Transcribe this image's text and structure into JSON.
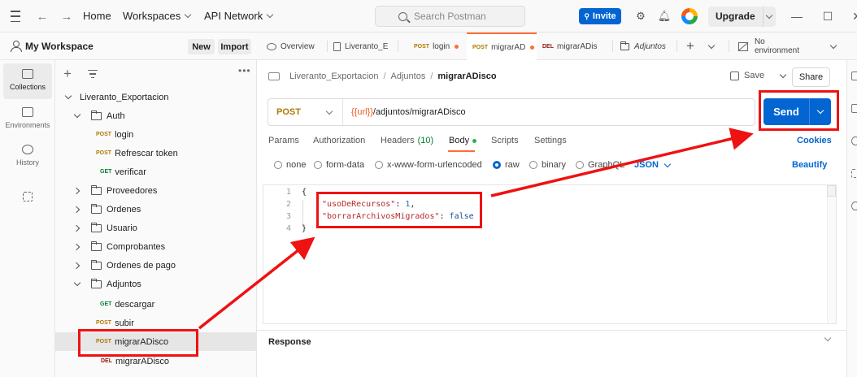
{
  "topbar": {
    "home": "Home",
    "workspaces": "Workspaces",
    "api_network": "API Network",
    "search_placeholder": "Search Postman",
    "invite": "Invite",
    "upgrade": "Upgrade"
  },
  "rail": {
    "items": [
      {
        "label": "Collections",
        "icon": "collections-icon"
      },
      {
        "label": "Environments",
        "icon": "environments-icon"
      },
      {
        "label": "History",
        "icon": "history-icon"
      },
      {
        "label": "",
        "icon": "apps-icon"
      }
    ]
  },
  "workspace": {
    "title": "My Workspace",
    "new_label": "New",
    "import_label": "Import"
  },
  "tree": {
    "collection": "Liveranto_Exportacion",
    "items": [
      {
        "type": "folder",
        "label": "Auth",
        "expanded": true
      },
      {
        "type": "request",
        "method": "POST",
        "label": "login"
      },
      {
        "type": "request",
        "method": "POST",
        "label": "Refrescar token"
      },
      {
        "type": "request",
        "method": "GET",
        "label": "verificar"
      },
      {
        "type": "folder",
        "label": "Proveedores",
        "expanded": false
      },
      {
        "type": "folder",
        "label": "Ordenes",
        "expanded": false
      },
      {
        "type": "folder",
        "label": "Usuario",
        "expanded": false
      },
      {
        "type": "folder",
        "label": "Comprobantes",
        "expanded": false
      },
      {
        "type": "folder",
        "label": "Ordenes de pago",
        "expanded": false
      },
      {
        "type": "folder",
        "label": "Adjuntos",
        "expanded": true
      },
      {
        "type": "request",
        "method": "GET",
        "label": "descargar"
      },
      {
        "type": "request",
        "method": "POST",
        "label": "subir"
      },
      {
        "type": "request",
        "method": "POST",
        "label": "migrarADisco",
        "selected": true
      },
      {
        "type": "request",
        "method": "DEL",
        "label": "migrarADisco"
      }
    ]
  },
  "tabs": {
    "items": [
      {
        "label": "Overview",
        "method": "",
        "icon": "overview-icon",
        "dirty": false
      },
      {
        "label": "Liveranto_E",
        "method": "",
        "icon": "collection-icon",
        "dirty": false
      },
      {
        "label": "login",
        "method": "POST",
        "dirty": true
      },
      {
        "label": "migrarAD",
        "method": "POST",
        "dirty": true,
        "active": true
      },
      {
        "label": "migrarADis",
        "method": "DEL",
        "dirty": false
      },
      {
        "label": "Adjuntos",
        "method": "",
        "icon": "folder-icon",
        "dirty": false
      }
    ],
    "environment": "No environment"
  },
  "request": {
    "breadcrumb": [
      "Liveranto_Exportacion",
      "Adjuntos",
      "migrarADisco"
    ],
    "save_label": "Save",
    "share_label": "Share",
    "method": "POST",
    "url_var": "{{url}}",
    "url_path": "/adjuntos/migrarADisco",
    "send_label": "Send",
    "subtabs": [
      "Params",
      "Authorization",
      "Headers",
      "Body",
      "Scripts",
      "Settings"
    ],
    "headers_count": "(10)",
    "cookies_label": "Cookies",
    "body_modes": [
      "none",
      "form-data",
      "x-www-form-urlencoded",
      "raw",
      "binary",
      "GraphQL"
    ],
    "body_mode_selected": "raw",
    "format": "JSON",
    "beautify_label": "Beautify",
    "body_lines": {
      "open": "{",
      "key1": "\"usoDeRecursos\"",
      "val1": "1",
      "key2": "\"borrarArchivosMigrados\"",
      "val2": "false",
      "close": "}"
    },
    "line_numbers": [
      "1",
      "2",
      "3",
      "4"
    ]
  },
  "response": {
    "title": "Response"
  },
  "colors": {
    "accent": "#ff6c37",
    "primary": "#0265d2",
    "annotation": "#ee1212",
    "post": "#ad7a03",
    "get": "#007f31",
    "del": "#8e1a10"
  }
}
